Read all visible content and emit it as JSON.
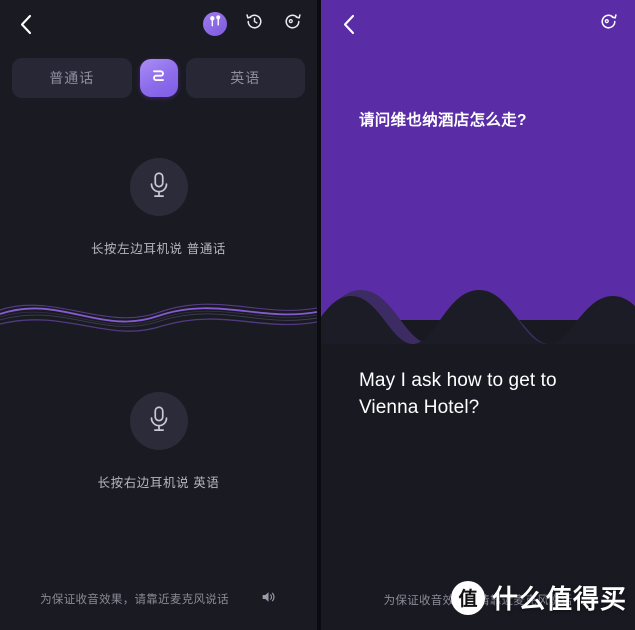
{
  "left": {
    "back_icon": "chevron-left-icon",
    "earbuds_icon": "earbuds-icon",
    "history_icon": "history-rewind-icon",
    "refresh_icon": "refresh-rotate-icon",
    "languages": {
      "source_label": "普通话",
      "target_label": "英语",
      "swap_icon": "swap-arrows-icon"
    },
    "mic_top": {
      "icon": "microphone-icon",
      "hint": "长按左边耳机说 普通话"
    },
    "mic_bottom": {
      "icon": "microphone-icon",
      "hint": "长按右边耳机说 英语"
    },
    "footer": {
      "hint": "为保证收音效果，请靠近麦克风说话",
      "speaker_icon": "speaker-volume-icon"
    }
  },
  "right": {
    "back_icon": "chevron-left-icon",
    "refresh_icon": "refresh-rotate-icon",
    "source_text": "请问维也纳酒店怎么走?",
    "target_text": "May I ask how to get to Vienna Hotel?",
    "footer": {
      "hint": "为保证收音效果，请靠近麦克风说话"
    }
  },
  "watermark": {
    "logo_char": "值",
    "text": "什么值得买"
  },
  "colors": {
    "left_bg": "#1a1a23",
    "right_bg": "#191922",
    "accent_purple": "#5a2da7",
    "pill_bg": "#272735",
    "swap_gradient_from": "#ab8df5",
    "swap_gradient_to": "#7f5ce6",
    "mic_circle": "#2b2b3a",
    "wave_purple": "#8b5fd9"
  }
}
